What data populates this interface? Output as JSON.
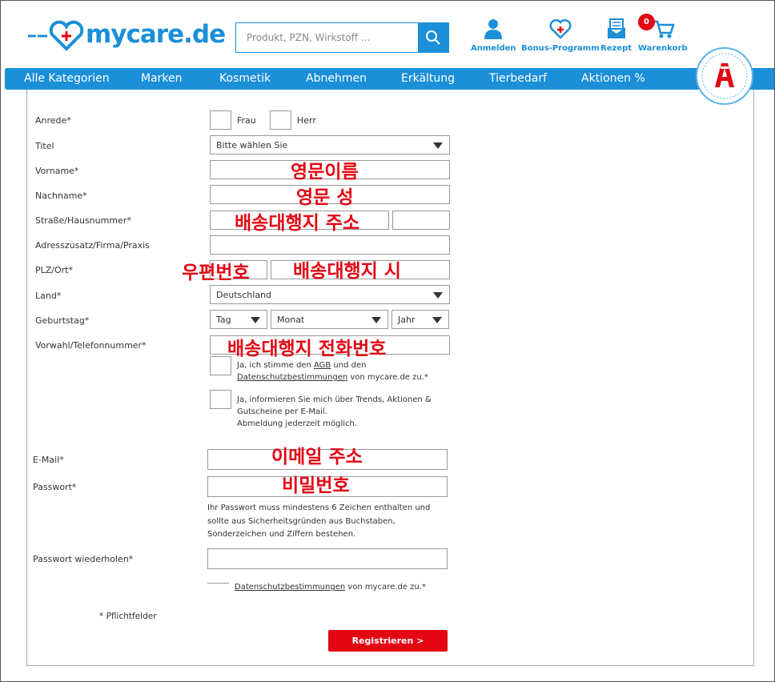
{
  "header": {
    "logo_text": "mycare.de",
    "search_placeholder": "Produkt, PZN, Wirkstoff ...",
    "icons": {
      "login": "Anmelden",
      "bonus": "Bonus-Programm",
      "rezept": "Rezept",
      "cart": "Warenkorb",
      "cart_count": "0"
    }
  },
  "nav": [
    "Alle Kategorien",
    "Marken",
    "Kosmetik",
    "Abnehmen",
    "Erkältung",
    "Tierbedarf",
    "Aktionen %"
  ],
  "form": {
    "anrede_label": "Anrede*",
    "frau": "Frau",
    "herr": "Herr",
    "titel_label": "Titel",
    "titel_value": "Bitte wählen Sie",
    "vorname_label": "Vorname*",
    "nachname_label": "Nachname*",
    "strasse_label": "Straße/Hausnummer*",
    "adresszusatz_label": "Adresszusatz/Firma/Praxis",
    "plz_label": "PLZ/Ort*",
    "land_label": "Land*",
    "land_value": "Deutschland",
    "geburtstag_label": "Geburtstag*",
    "tag": "Tag",
    "monat": "Monat",
    "jahr": "Jahr",
    "telefon_label": "Vorwahl/Telefonnummer*",
    "agb_text_1": "Ja, ich stimme den ",
    "agb_link": "AGB",
    "agb_text_2": " und den",
    "datenschutz_link": "Datenschutzbestimmungen",
    "agb_text_3": " von mycare.de zu.*",
    "newsletter_line1": "Ja, informieren Sie mich über Trends, Aktionen &",
    "newsletter_line2": "Gutscheine per E-Mail.",
    "newsletter_line3": "Abmeldung jederzeit möglich.",
    "email_label": "E-Mail*",
    "passwort_label": "Passwort*",
    "pw_hint_1": "Ihr Passwort muss mindestens 6 Zeichen enthalten und",
    "pw_hint_2": "sollte aus Sicherheitsgründen aus Buchstaben,",
    "pw_hint_3": "Sonderzeichen und Ziffern bestehen.",
    "passwort_wdh_label": "Passwort wiederholen*",
    "datenschutz2_link": "Datenschutzbestimmungen",
    "datenschutz2_text": " von mycare.de zu.*",
    "pflicht": "* Pflichtfelder",
    "submit": "Registrieren >"
  },
  "annotations": {
    "vorname": "영문이름",
    "nachname": "영문 성",
    "strasse": "배송대행지 주소",
    "plz": "우편번호",
    "ort": "배송대행지 시",
    "telefon": "배송대행지 전화번호",
    "email": "이메일 주소",
    "passwort": "비밀번호"
  },
  "colors": {
    "brand_blue": "#1b8fd8",
    "accent_red": "#e30613",
    "annotation_red": "#e30613"
  }
}
